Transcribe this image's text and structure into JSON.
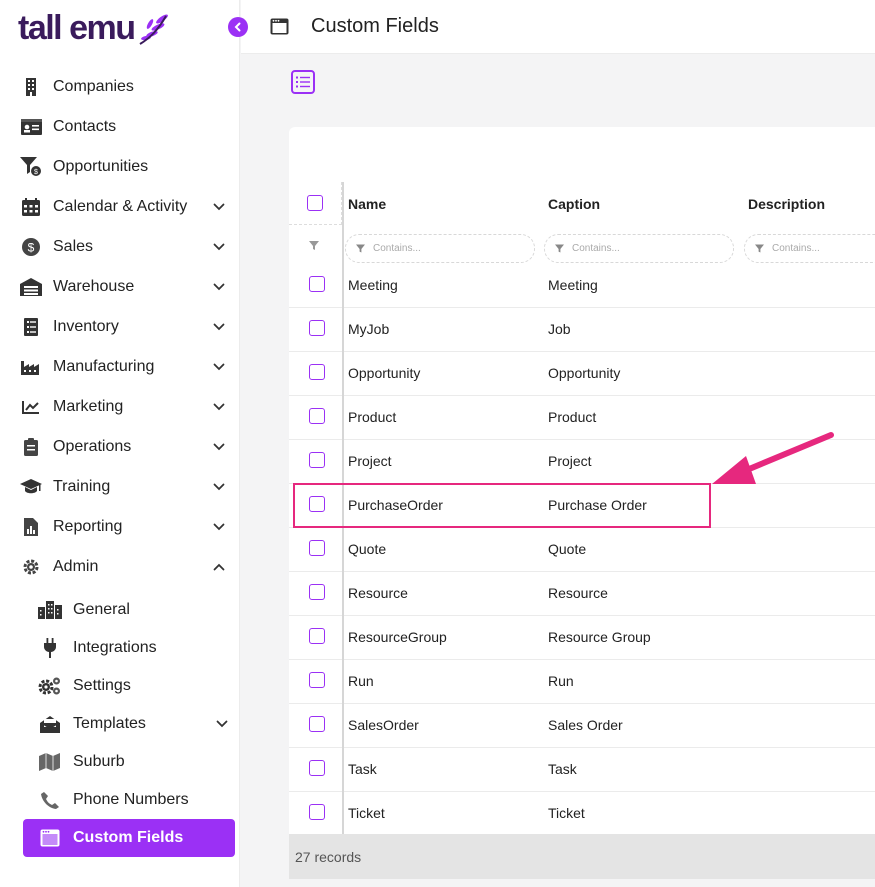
{
  "app": {
    "logo_text": "tall emu",
    "page_title": "Custom Fields"
  },
  "colors": {
    "accent": "#9b30f5",
    "brand": "#3a1b5c",
    "highlight": "#e6287e"
  },
  "sidebar": {
    "items": [
      {
        "label": "Companies",
        "icon": "building-icon",
        "expandable": false
      },
      {
        "label": "Contacts",
        "icon": "contact-card-icon",
        "expandable": false
      },
      {
        "label": "Opportunities",
        "icon": "funnel-dollar-icon",
        "expandable": false
      },
      {
        "label": "Calendar & Activity",
        "icon": "calendar-icon",
        "expandable": true
      },
      {
        "label": "Sales",
        "icon": "dollar-circle-icon",
        "expandable": true
      },
      {
        "label": "Warehouse",
        "icon": "warehouse-icon",
        "expandable": true
      },
      {
        "label": "Inventory",
        "icon": "inventory-list-icon",
        "expandable": true
      },
      {
        "label": "Manufacturing",
        "icon": "factory-icon",
        "expandable": true
      },
      {
        "label": "Marketing",
        "icon": "trend-chart-icon",
        "expandable": true
      },
      {
        "label": "Operations",
        "icon": "clipboard-icon",
        "expandable": true
      },
      {
        "label": "Training",
        "icon": "graduation-cap-icon",
        "expandable": true
      },
      {
        "label": "Reporting",
        "icon": "report-icon",
        "expandable": true
      },
      {
        "label": "Admin",
        "icon": "gear-icon",
        "expandable": true,
        "expanded": true
      }
    ],
    "admin_items": [
      {
        "label": "General",
        "icon": "city-icon"
      },
      {
        "label": "Integrations",
        "icon": "plug-icon"
      },
      {
        "label": "Settings",
        "icon": "cogs-icon"
      },
      {
        "label": "Templates",
        "icon": "envelope-open-icon",
        "expandable": true
      },
      {
        "label": "Suburb",
        "icon": "map-icon"
      },
      {
        "label": "Phone Numbers",
        "icon": "phone-icon"
      },
      {
        "label": "Custom Fields",
        "icon": "window-icon",
        "active": true
      }
    ]
  },
  "grid": {
    "columns": [
      "Name",
      "Caption",
      "Description"
    ],
    "filter_placeholder": "Contains...",
    "rows": [
      {
        "name": "Meeting",
        "caption": "Meeting"
      },
      {
        "name": "MyJob",
        "caption": "Job"
      },
      {
        "name": "Opportunity",
        "caption": "Opportunity"
      },
      {
        "name": "Product",
        "caption": "Product"
      },
      {
        "name": "Project",
        "caption": "Project"
      },
      {
        "name": "PurchaseOrder",
        "caption": "Purchase Order",
        "highlighted": true
      },
      {
        "name": "Quote",
        "caption": "Quote"
      },
      {
        "name": "Resource",
        "caption": "Resource"
      },
      {
        "name": "ResourceGroup",
        "caption": "Resource Group"
      },
      {
        "name": "Run",
        "caption": "Run"
      },
      {
        "name": "SalesOrder",
        "caption": "Sales Order"
      },
      {
        "name": "Task",
        "caption": "Task"
      },
      {
        "name": "Ticket",
        "caption": "Ticket"
      }
    ],
    "record_count": "27 records"
  }
}
